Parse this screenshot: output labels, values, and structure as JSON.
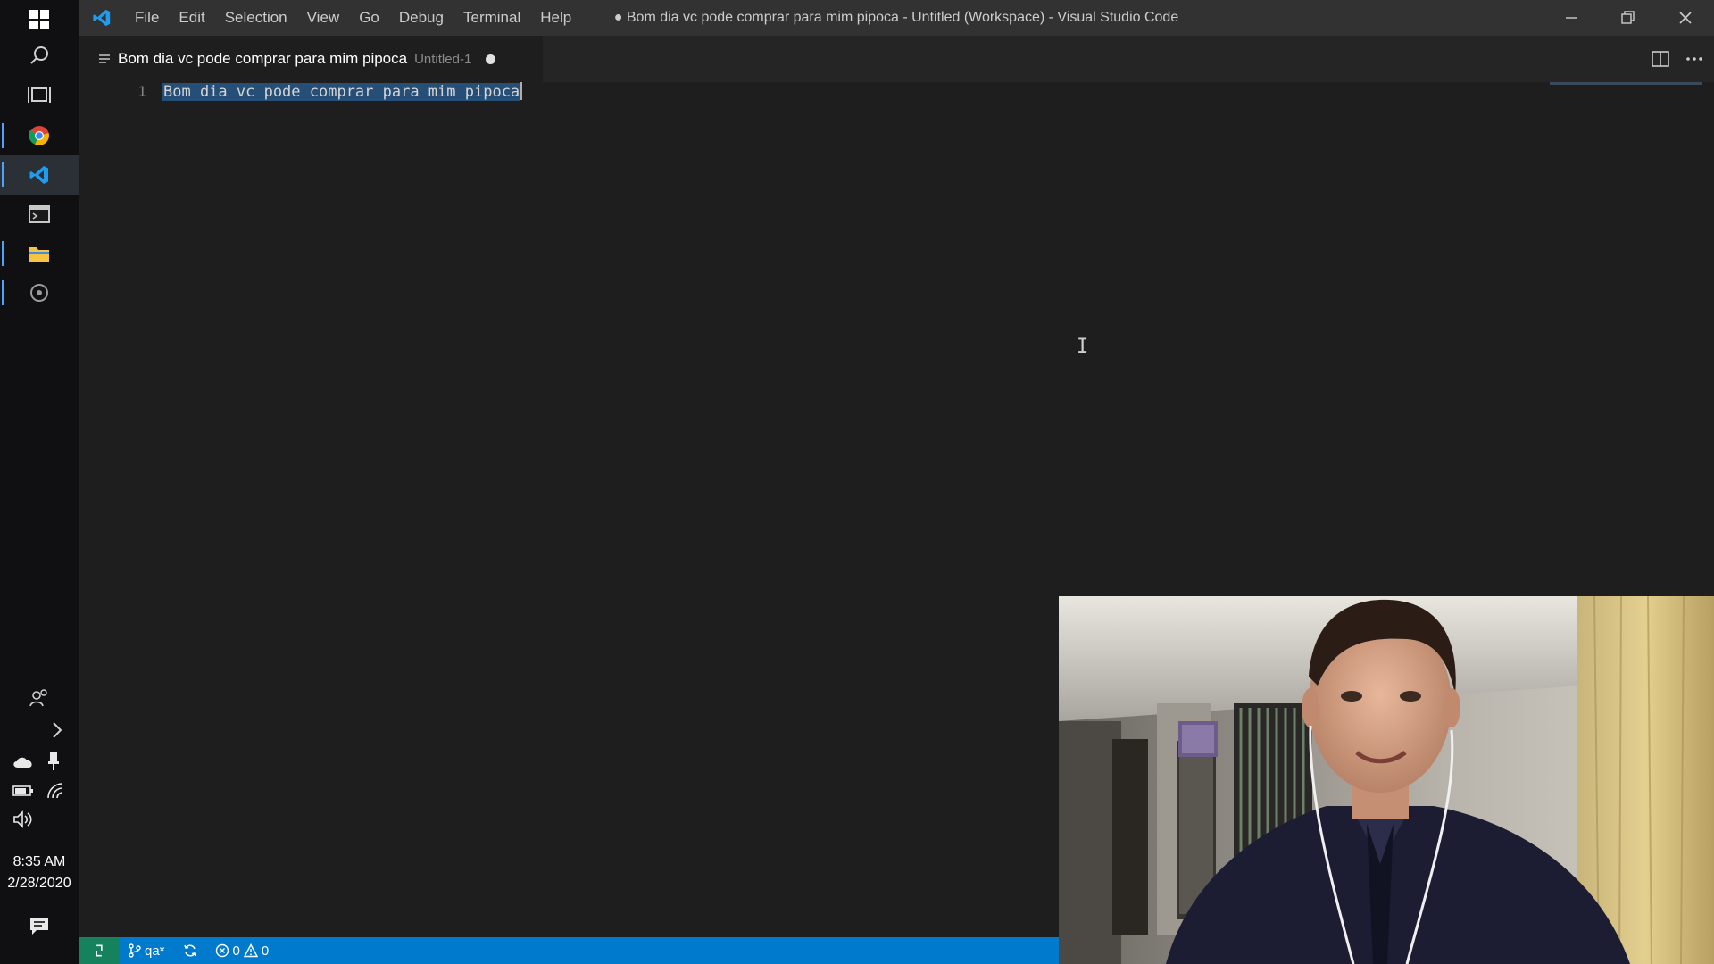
{
  "taskbar": {
    "clock_time": "8:35 AM",
    "clock_date": "2/28/2020"
  },
  "titlebar": {
    "window_title": "● Bom dia vc pode comprar para mim pipoca - Untitled (Workspace) - Visual Studio Code",
    "menu": [
      "File",
      "Edit",
      "Selection",
      "View",
      "Go",
      "Debug",
      "Terminal",
      "Help"
    ]
  },
  "tab": {
    "title": "Bom dia vc pode comprar para mim pipoca",
    "description": "Untitled-1"
  },
  "editor": {
    "line_number": "1",
    "line_text": "Bom dia vc pode comprar para mim pipoca"
  },
  "statusbar": {
    "branch": "qa*",
    "errors": "0",
    "warnings": "0"
  },
  "colors": {
    "statusbar": "#007acc",
    "remote": "#16825d",
    "selection": "#264f78",
    "accent": "#4aa3ff"
  }
}
